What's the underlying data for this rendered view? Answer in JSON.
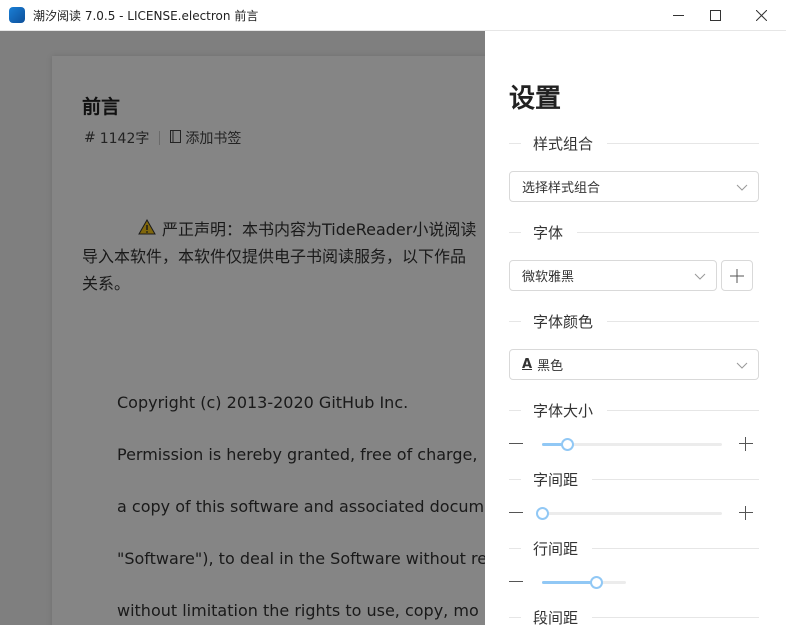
{
  "window": {
    "title": "潮汐阅读 7.0.5 - LICENSE.electron 前言"
  },
  "reader": {
    "chapter_title": "前言",
    "word_count": "1142字",
    "bookmark_label": "添加书签",
    "notice_line1": "严正声明：本书内容为TideReader小说阅读",
    "notice_line2": "导入本软件，本软件仅提供电子书阅读服务，以下作品",
    "notice_line3": "关系。",
    "license_lines": [
      "Copyright (c) 2013-2020 GitHub Inc.",
      "Permission is hereby granted, free of charge,",
      "a copy of this software and associated docum",
      "\"Software\"), to deal in the Software without re",
      "without limitation the rights to use, copy, mo"
    ]
  },
  "settings": {
    "title": "设置",
    "style_combo_label": "样式组合",
    "style_combo_value": "选择样式组合",
    "font_label": "字体",
    "font_value": "微软雅黑",
    "font_color_label": "字体颜色",
    "font_color_value": "黑色",
    "font_size_label": "字体大小",
    "letter_spacing_label": "字间距",
    "line_spacing_label": "行间距",
    "paragraph_spacing_label": "段间距",
    "font_size_level": 0.14,
    "letter_spacing_level": 0.0,
    "line_spacing_level": 0.3
  },
  "colors": {
    "slider_accent": "#91c8f5",
    "app_icon": "#1a7fd6"
  }
}
